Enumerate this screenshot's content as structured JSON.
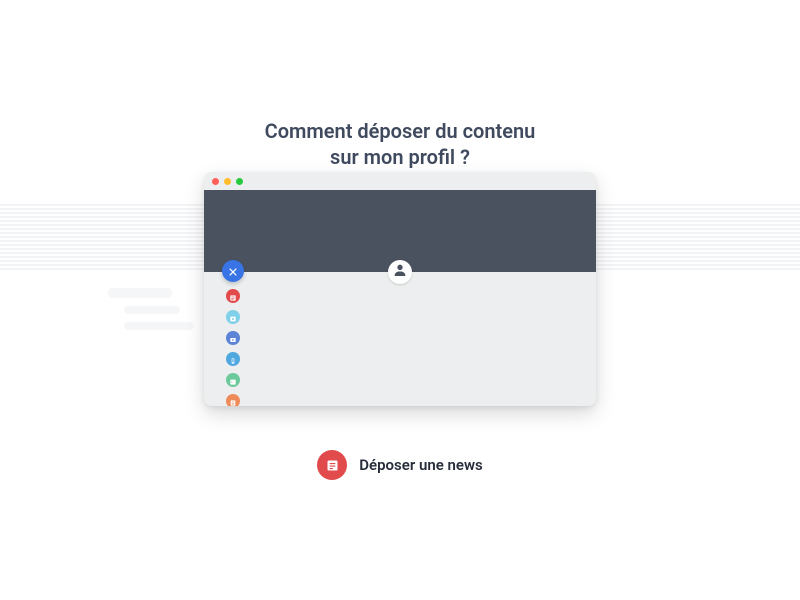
{
  "title": "Comment déposer du contenu\nsur mon profil ?",
  "colors": {
    "fab": "#3974e6",
    "header": "#4a5260",
    "action": "#e24b4b"
  },
  "menu_items": [
    {
      "name": "news",
      "color": "#e24b4b"
    },
    {
      "name": "photo",
      "color": "#7fd0e8"
    },
    {
      "name": "video",
      "color": "#5b84d6"
    },
    {
      "name": "mobile",
      "color": "#4fa9e0"
    },
    {
      "name": "event",
      "color": "#6cc99c"
    },
    {
      "name": "doc",
      "color": "#ef8a5a"
    }
  ],
  "bottom_action": {
    "label": "Déposer une news"
  }
}
